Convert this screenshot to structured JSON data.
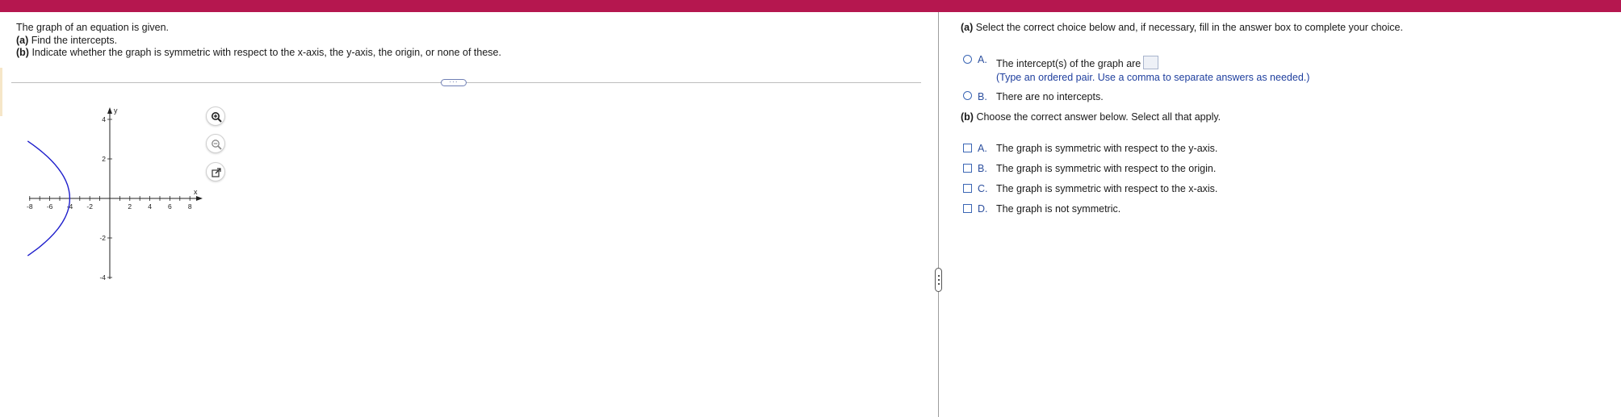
{
  "question": {
    "line1": "The graph of an equation is given.",
    "part_a_label": "(a)",
    "part_a_text": " Find the intercepts.",
    "part_b_label": "(b)",
    "part_b_text": " Indicate whether the graph is symmetric with respect to the x-axis, the y-axis, the origin, or none of these."
  },
  "graph": {
    "x_axis_label": "x",
    "y_axis_label": "y",
    "x_ticks": [
      "-8",
      "-6",
      "-4",
      "-2",
      "2",
      "4",
      "6",
      "8"
    ],
    "y_ticks": [
      "4",
      "2",
      "-2",
      "-4"
    ],
    "curve_color": "#1f1fcc",
    "tools": [
      "zoom-in-icon",
      "zoom-out-icon",
      "popout-icon"
    ]
  },
  "part_a": {
    "title_label": "(a)",
    "title_text": " Select the correct choice below and, if necessary, fill in the answer box to complete your choice.",
    "option_a_letter": "A.",
    "option_a_text": "The intercept(s) of the graph are",
    "option_a_hint": "(Type an ordered pair. Use a comma to separate answers as needed.)",
    "option_b_letter": "B.",
    "option_b_text": "There are no intercepts."
  },
  "part_b": {
    "title_label": "(b)",
    "title_text": " Choose the correct answer below. Select all that apply.",
    "options": [
      {
        "letter": "A.",
        "text": "The graph is symmetric with respect to the y-axis."
      },
      {
        "letter": "B.",
        "text": "The graph is symmetric with respect to the origin."
      },
      {
        "letter": "C.",
        "text": "The graph is symmetric with respect to the x-axis."
      },
      {
        "letter": "D.",
        "text": "The graph is not symmetric."
      }
    ]
  },
  "colors": {
    "header": "#b5174f",
    "accent": "#3b66b5"
  }
}
